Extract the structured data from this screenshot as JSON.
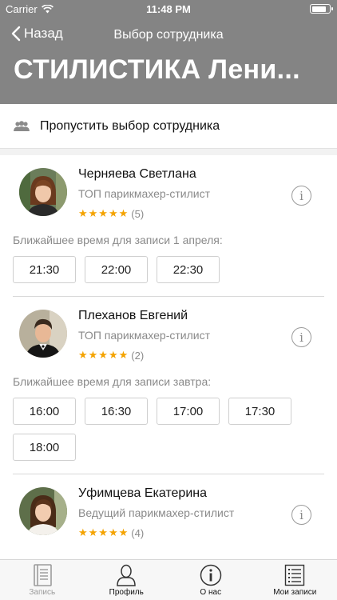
{
  "status_bar": {
    "carrier": "Carrier",
    "time": "11:48 PM",
    "battery_level": 0.85
  },
  "nav": {
    "back_label": "Назад",
    "title": "Выбор сотрудника"
  },
  "page_title": "СТИЛИСТИКА Лени...",
  "skip": {
    "label": "Пропустить выбор сотрудника",
    "icon": "users-icon"
  },
  "staff": [
    {
      "name": "Черняева Светлана",
      "role": "ТОП парикмахер-стилист",
      "stars": "★★★★★",
      "rating_count": "(5)",
      "slots_hint": "Ближайшее время для записи 1 апреля:",
      "slots": [
        "21:30",
        "22:00",
        "22:30"
      ]
    },
    {
      "name": "Плеханов Евгений",
      "role": "ТОП парикмахер-стилист",
      "stars": "★★★★★",
      "rating_count": "(2)",
      "slots_hint": "Ближайшее время для записи завтра:",
      "slots": [
        "16:00",
        "16:30",
        "17:00",
        "17:30",
        "18:00"
      ]
    },
    {
      "name": "Уфимцева Екатерина",
      "role": "Ведущий парикмахер-стилист",
      "stars": "★★★★★",
      "rating_count": "(4)"
    }
  ],
  "info_glyph": "i",
  "tabs": [
    {
      "label": "Запись",
      "icon": "notebook-icon",
      "state": "inactive"
    },
    {
      "label": "Профиль",
      "icon": "person-icon",
      "state": "active"
    },
    {
      "label": "О нас",
      "icon": "info-icon",
      "state": "active"
    },
    {
      "label": "Мои записи",
      "icon": "list-icon",
      "state": "active"
    }
  ],
  "colors": {
    "header": "#848484",
    "star": "#f4a300",
    "muted": "#8a8a8a"
  }
}
